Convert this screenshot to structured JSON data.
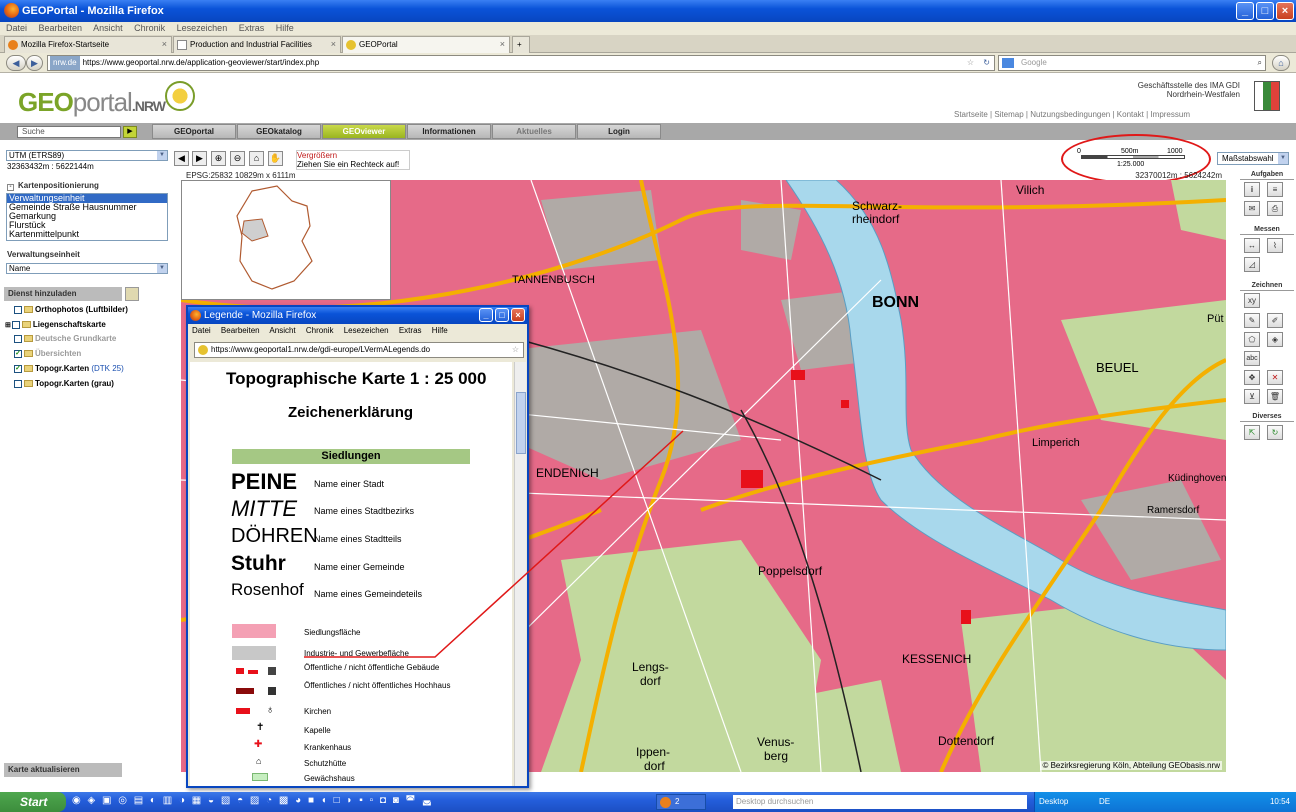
{
  "window": {
    "title": "GEOPortal - Mozilla Firefox"
  },
  "menubar": [
    "Datei",
    "Bearbeiten",
    "Ansicht",
    "Chronik",
    "Lesezeichen",
    "Extras",
    "Hilfe"
  ],
  "tabs": [
    {
      "label": "Mozilla Firefox-Startseite"
    },
    {
      "label": "Production and Industrial Facilities"
    },
    {
      "label": "GEOPortal"
    }
  ],
  "nav": {
    "site": "nrw.de",
    "url": "https://www.geoportal.nrw.de/application-geoviewer/start/index.php",
    "search_placeholder": "Google"
  },
  "header": {
    "logo_geo": "GEO",
    "logo_portal": "portal",
    "logo_nrw": ".NRW",
    "office_line1": "Geschäftsstelle des IMA GDI",
    "office_line2": "Nordrhein-Westfalen",
    "links": "Startseite | Sitemap | Nutzungsbedingungen | Kontakt | Impressum"
  },
  "mainmenu": {
    "search_placeholder": "Suche",
    "items": [
      "GEOportal",
      "GEOkatalog",
      "GEOviewer",
      "Informationen",
      "Aktuelles",
      "Login"
    ]
  },
  "left": {
    "crs": "UTM (ETRS89)",
    "coords": "32363432m : 5622144m",
    "positioning_title": "Kartenpositionierung",
    "positioning_items": [
      "Verwaltungseinheit",
      "Gemeinde Straße Hausnummer",
      "Gemarkung",
      "Flurstück",
      "Kartenmittelpunkt"
    ],
    "admin_title": "Verwaltungseinheit",
    "admin_select": "Name",
    "add_service": "Dienst hinzuladen",
    "layers": [
      {
        "label": "Orthophotos (Luftbilder)",
        "checked": false,
        "grey": false
      },
      {
        "label": "Liegenschaftskarte",
        "checked": false,
        "grey": false
      },
      {
        "label": "Deutsche Grundkarte",
        "checked": false,
        "grey": true
      },
      {
        "label": "Übersichten",
        "checked": true,
        "grey": true
      },
      {
        "label": "Topogr.Karten",
        "suffix": "(DTK 25)",
        "checked": true,
        "grey": false
      },
      {
        "label": "Topogr.Karten (grau)",
        "checked": false,
        "grey": false
      }
    ],
    "update_map": "Karte aktualisieren"
  },
  "maptools": {
    "hint_title": "Vergrößern",
    "hint_text": "Ziehen Sie ein Rechteck auf!",
    "scale_ticks": [
      "0",
      "500m",
      "1000"
    ],
    "scale_ratio": "1:25.000",
    "scale_select": "Maßstabswahl",
    "epsg": "EPSG:25832   10829m x 6111m",
    "cursor_coords": "32370012m : 5624242m"
  },
  "map": {
    "labels": [
      "Vilich",
      "Schwarz-",
      "rheindorf",
      "TANNENBUSCH",
      "BONN",
      "BEUEL",
      "ENDENICH",
      "Poppelsdorf",
      "KESSENICH",
      "Venus-",
      "berg",
      "Dottendorf",
      "Lengs-",
      "dorf",
      "Ippen-",
      "dorf",
      "Limperich",
      "Küdinghoven",
      "Ramersdorf",
      "Püt"
    ],
    "copyright": "© Bezirksregierung Köln, Abteilung GEObasis.nrw",
    "colors": {
      "settlement": "#e66a88",
      "industry": "#b0aaa6",
      "forest": "#c2d99e",
      "water": "#a8d8ec",
      "roads": "#f4b000"
    }
  },
  "right": {
    "aufgaben": "Aufgaben",
    "messen": "Messen",
    "zeichnen": "Zeichnen",
    "diverses": "Diverses",
    "xy_label": "xy",
    "abc_label": "abc"
  },
  "popup": {
    "title": "Legende - Mozilla Firefox",
    "menu": [
      "Datei",
      "Bearbeiten",
      "Ansicht",
      "Chronik",
      "Lesezeichen",
      "Extras",
      "Hilfe"
    ],
    "url": "https://www.geoportal1.nrw.de/gdi-europe/LVermALegends.do",
    "heading": "Topographische Karte 1 : 25 000",
    "subheading": "Zeichenerklärung",
    "section": "Siedlungen",
    "names": [
      {
        "sample": "PEINE",
        "desc": "Name einer Stadt"
      },
      {
        "sample": "MITTE",
        "desc": "Name eines Stadtbezirks"
      },
      {
        "sample": "DÖHREN",
        "desc": "Name eines Stadtteils"
      },
      {
        "sample": "Stuhr",
        "desc": "Name einer Gemeinde"
      },
      {
        "sample": "Rosenhof",
        "desc": "Name eines Gemeindeteils"
      }
    ],
    "symbols": [
      {
        "desc": "Siedlungsfläche"
      },
      {
        "desc": "Industrie- und Gewerbefläche"
      },
      {
        "desc": "Öffentliche / nicht öffentliche Gebäude"
      },
      {
        "desc": "Öffentliches / nicht öffentliches Hochhaus"
      },
      {
        "desc": "Kirchen"
      },
      {
        "desc": "Kapelle"
      },
      {
        "desc": "Krankenhaus"
      },
      {
        "desc": "Schutzhütte"
      },
      {
        "desc": "Gewächshaus"
      }
    ]
  },
  "taskbar": {
    "start": "Start",
    "task_count": "2",
    "desktop_search": "Desktop durchsuchen",
    "desktop": "Desktop",
    "lang": "DE",
    "clock": "10:54"
  }
}
